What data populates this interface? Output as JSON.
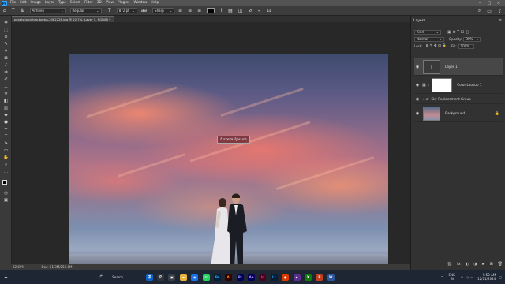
{
  "app": {
    "menu": [
      "File",
      "Edit",
      "Image",
      "Layer",
      "Type",
      "Select",
      "Filter",
      "3D",
      "View",
      "Plugins",
      "Window",
      "Help"
    ],
    "logo": "Ps"
  },
  "options": {
    "font_family": "Antihen",
    "font_style": "Regular",
    "font_size": "872 pt",
    "antialias": "Sharp",
    "color": "#000000"
  },
  "document": {
    "tab": "pexels-jonathan-borba-3062228.jpg @ 22.7% (Layer 1, RGB/8) *",
    "text_layer": "Lorem Ipsum"
  },
  "status": {
    "zoom": "22.69%",
    "doc": "Doc: 51.3M/259.8M"
  },
  "layers_panel": {
    "title": "Layers",
    "kind": "Kind",
    "blend": "Normal",
    "opacity_label": "Opacity:",
    "opacity": "30%",
    "lock_label": "Lock:",
    "fill_label": "Fill:",
    "fill": "100%",
    "layers": [
      {
        "name": "Layer 1",
        "thumb": "T"
      },
      {
        "name": "Color Lookup 1",
        "thumb": ""
      },
      {
        "name": "Sky Replacement Group",
        "thumb": ""
      },
      {
        "name": "Background",
        "thumb": ""
      }
    ]
  },
  "taskbar": {
    "search": "Search",
    "lang": "ENG IN",
    "time": "9:50 AM",
    "date": "12/01/2024",
    "apps": [
      "Ps",
      "Ai",
      "Pr",
      "Ae",
      "Id",
      "Lr"
    ]
  },
  "colors": {
    "accent": "#31a8ff",
    "panel": "#323232",
    "workspace": "#282828"
  }
}
